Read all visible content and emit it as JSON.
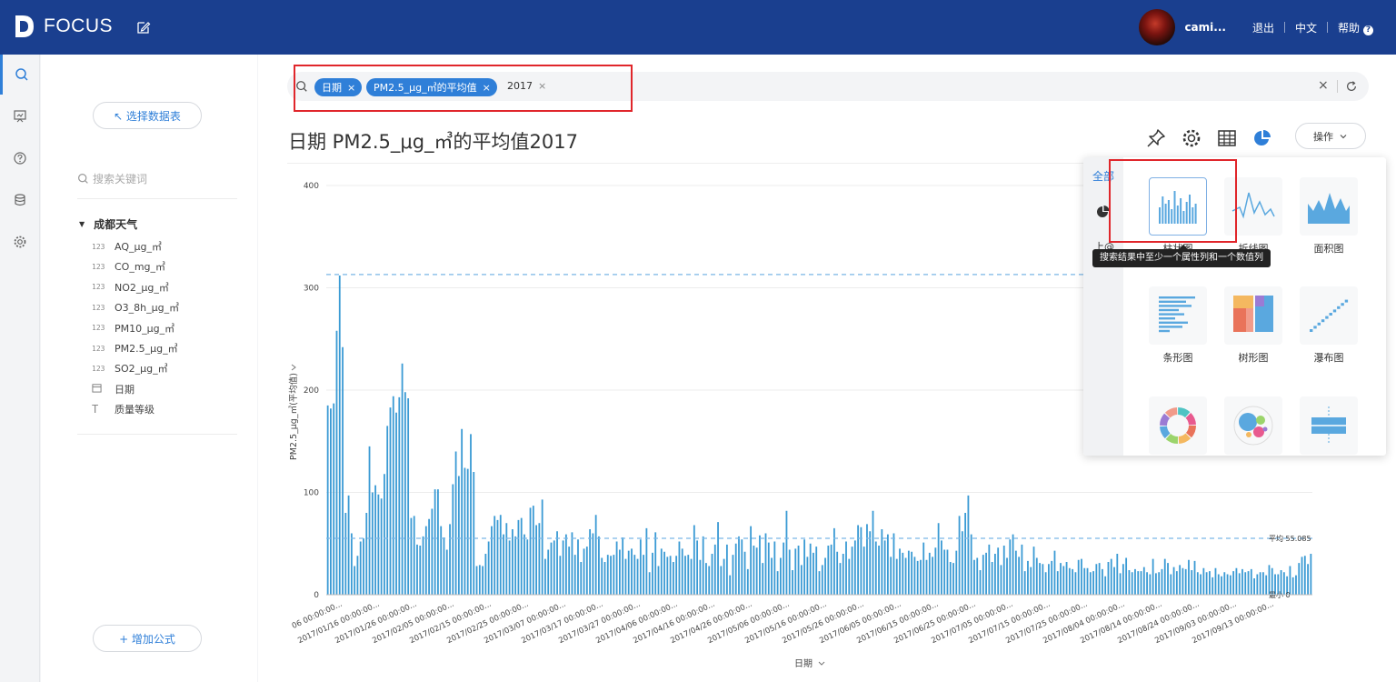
{
  "topbar": {
    "brand": "FOCUS",
    "username": "cami...",
    "links": [
      "退出",
      "中文",
      "帮助"
    ],
    "help_glyph": "?"
  },
  "rail": {
    "icons": [
      "search-icon",
      "dashboard-icon",
      "help-icon",
      "database-icon",
      "settings-icon"
    ]
  },
  "panel": {
    "select_table_label": "↖ 选择数据表",
    "search_placeholder": "搜索关键词",
    "table_name": "成都天气",
    "columns": [
      {
        "type": "number",
        "type_glyph": "123",
        "name": "AQ_μg_㎥"
      },
      {
        "type": "number",
        "type_glyph": "123",
        "name": "CO_mg_㎥"
      },
      {
        "type": "number",
        "type_glyph": "123",
        "name": "NO2_μg_㎥"
      },
      {
        "type": "number",
        "type_glyph": "123",
        "name": "O3_8h_μg_㎥"
      },
      {
        "type": "number",
        "type_glyph": "123",
        "name": "PM10_μg_㎥"
      },
      {
        "type": "number",
        "type_glyph": "123",
        "name": "PM2.5_μg_㎥"
      },
      {
        "type": "number",
        "type_glyph": "123",
        "name": "SO2_μg_㎥"
      },
      {
        "type": "date",
        "type_glyph": "",
        "name": "日期"
      },
      {
        "type": "text",
        "type_glyph": "T",
        "name": "质量等级"
      }
    ],
    "add_formula_label": "+ 增加公式"
  },
  "search": {
    "tokens": [
      "日期",
      "PM2.5_μg_㎥的平均值"
    ],
    "plain_token": "2017",
    "close_glyph": "×",
    "clear_glyph": "×"
  },
  "title": "日期 PM2.5_μg_㎥的平均值2017",
  "ops_label": "操作",
  "dropdown": {
    "all_label": "全部",
    "side_label": "上@",
    "charts": [
      {
        "name": "柱状图",
        "icon": "bar-chart-icon",
        "selected": true
      },
      {
        "name": "折线图",
        "icon": "line-chart-icon",
        "selected": false
      },
      {
        "name": "面积图",
        "icon": "area-chart-icon",
        "selected": false
      },
      {
        "name": "条形图",
        "icon": "horizontal-bar-chart-icon",
        "selected": false
      },
      {
        "name": "树形图",
        "icon": "treemap-icon",
        "selected": false
      },
      {
        "name": "瀑布图",
        "icon": "waterfall-chart-icon",
        "selected": false
      },
      {
        "name": "",
        "icon": "donut-chart-icon",
        "selected": false
      },
      {
        "name": "",
        "icon": "bubble-chart-icon",
        "selected": false
      },
      {
        "name": "",
        "icon": "boxplot-icon",
        "selected": false
      }
    ],
    "tooltip": "搜索结果中至少一个属性列和一个数值列"
  },
  "colors": {
    "accent": "#2f7fd8",
    "topbar": "#1a3f8f",
    "bar": "#3a9ad4",
    "highlight_box": "#e0262b"
  },
  "chart_data": {
    "type": "bar",
    "ylabel": "PM2.5_μg_㎥(平均值)",
    "xlabel": "日期",
    "ylim": [
      0,
      400
    ],
    "yticks": [
      0,
      100,
      200,
      300,
      400
    ],
    "x_tick_labels": [
      "06 00:00:00...",
      "2017/01/16 00:00:00...",
      "2017/01/26 00:00:00...",
      "2017/02/05 00:00:00...",
      "2017/02/15 00:00:00...",
      "2017/02/25 00:00:00...",
      "2017/03/07 00:00:00...",
      "2017/03/17 00:00:00...",
      "2017/03/27 00:00:00...",
      "2017/04/06 00:00:00...",
      "2017/04/16 00:00:00...",
      "2017/04/26 00:00:00...",
      "2017/05/06 00:00:00...",
      "2017/05/16 00:00:00...",
      "2017/05/26 00:00:00...",
      "2017/06/05 00:00:00...",
      "2017/06/15 00:00:00...",
      "2017/06/25 00:00:00...",
      "2017/07/05 00:00:00...",
      "2017/07/15 00:00:00...",
      "2017/07/25 00:00:00...",
      "2017/08/04 00:00:00...",
      "2017/08/14 00:00:00...",
      "2017/08/24 00:00:00...",
      "2017/09/03 00:00:00...",
      "2017/09/13 00:00:00..."
    ],
    "reference_lines": [
      {
        "label": "",
        "value": 313
      },
      {
        "label": "平均 55.085",
        "value": 55.085
      },
      {
        "label": "最小 0",
        "value": 0
      }
    ],
    "values": [
      185,
      182,
      187,
      258,
      312,
      242,
      80,
      97,
      60,
      28,
      38,
      52,
      55,
      80,
      145,
      100,
      107,
      98,
      94,
      118,
      165,
      183,
      194,
      178,
      193,
      226,
      198,
      192,
      75,
      77,
      49,
      48,
      57,
      67,
      74,
      84,
      103,
      103,
      67,
      56,
      44,
      69,
      108,
      140,
      116,
      162,
      124,
      123,
      157,
      120,
      28,
      29,
      28,
      40,
      52,
      67,
      77,
      73,
      78,
      59,
      70,
      53,
      64,
      57,
      73,
      75,
      59,
      54,
      85,
      87,
      68,
      70,
      93,
      35,
      44,
      51,
      53,
      62,
      38,
      53,
      59,
      47,
      61,
      39,
      54,
      32,
      45,
      47,
      64,
      60,
      78,
      57,
      36,
      32,
      39,
      38,
      39,
      52,
      44,
      56,
      35,
      43,
      45,
      39,
      35,
      54,
      39,
      65,
      22,
      41,
      61,
      28,
      45,
      42,
      37,
      38,
      32,
      38,
      52,
      45,
      38,
      39,
      35,
      68,
      53,
      34,
      57,
      31,
      28,
      40,
      49,
      71,
      28,
      35,
      49,
      19,
      39,
      50,
      57,
      54,
      42,
      25,
      67,
      48,
      46,
      58,
      31,
      60,
      51,
      36,
      52,
      23,
      36,
      51,
      82,
      44,
      24,
      45,
      48,
      29,
      54,
      37,
      50,
      41,
      47,
      23,
      29,
      36,
      48,
      49,
      65,
      42,
      31,
      40,
      52,
      35,
      47,
      53,
      68,
      66,
      47,
      69,
      62,
      82,
      52,
      48,
      64,
      53,
      59,
      37,
      60,
      35,
      45,
      41,
      36,
      43,
      42,
      37,
      33,
      34,
      51,
      34,
      41,
      37,
      46,
      70,
      53,
      44,
      44,
      32,
      31,
      43,
      77,
      62,
      80,
      97,
      59,
      34,
      36,
      24,
      39,
      41,
      49,
      32,
      40,
      46,
      29,
      48,
      36,
      54,
      59,
      43,
      37,
      49,
      23,
      33,
      27,
      47,
      36,
      31,
      30,
      22,
      30,
      33,
      43,
      23,
      31,
      28,
      32,
      26,
      25,
      22,
      34,
      35,
      26,
      26,
      22,
      23,
      30,
      31,
      25,
      18,
      32,
      35,
      27,
      40,
      21,
      30,
      36,
      24,
      22,
      25,
      23,
      23,
      27,
      22,
      20,
      35,
      21,
      22,
      25,
      35,
      31,
      20,
      27,
      23,
      29,
      26,
      25,
      34,
      24,
      33,
      22,
      20,
      26,
      22,
      23,
      17,
      26,
      20,
      18,
      22,
      20,
      19,
      23,
      26,
      21,
      25,
      22,
      23,
      25,
      16,
      20,
      22,
      22,
      19,
      29,
      26,
      20,
      20,
      24,
      22,
      18,
      28,
      17,
      19,
      31,
      37,
      38,
      30,
      40
    ]
  }
}
